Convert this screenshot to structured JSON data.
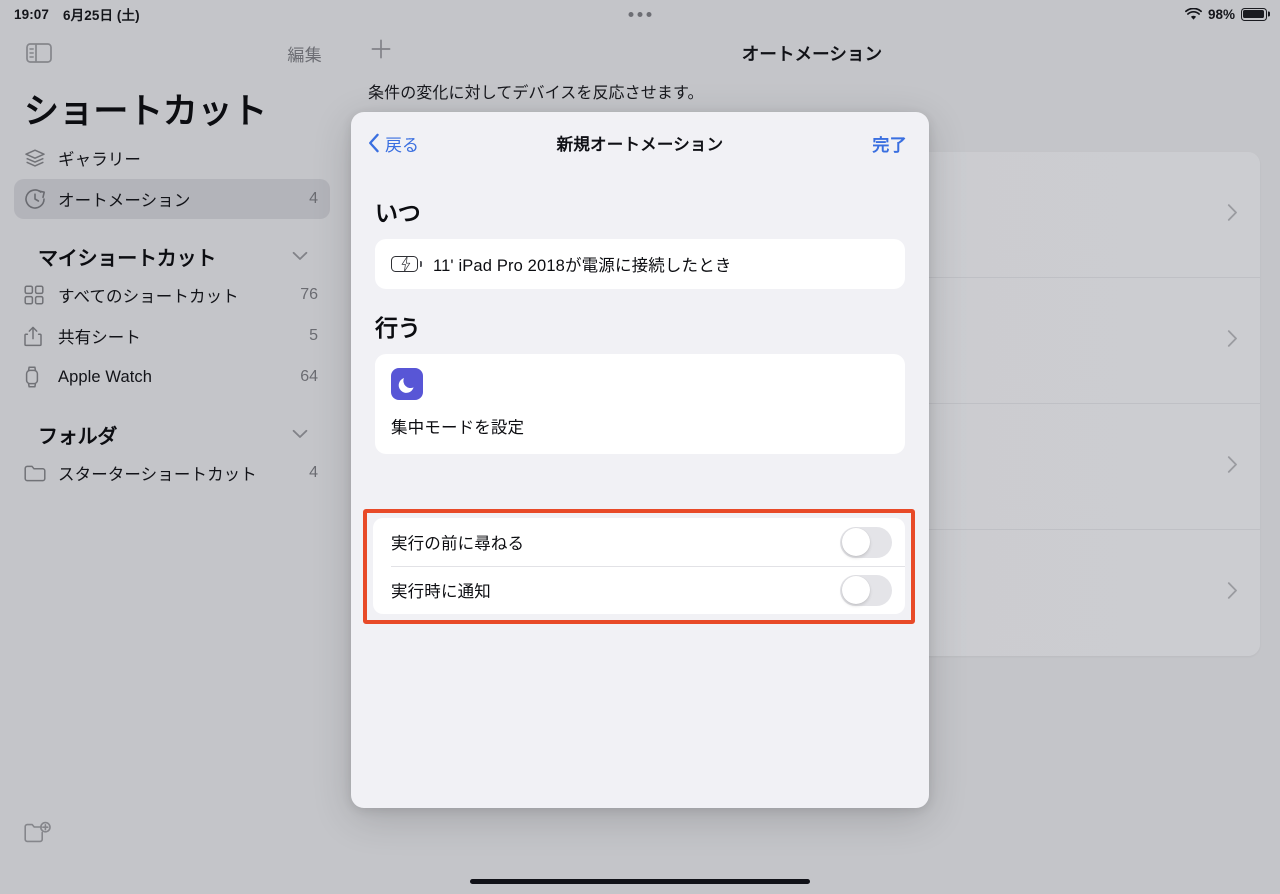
{
  "status_bar": {
    "time": "19:07",
    "date": "6月25日 (土)",
    "battery_percent": "98%",
    "wifi_icon": "wifi-icon",
    "battery_icon": "battery-icon",
    "multitask_icon": "multitasking-dots-icon"
  },
  "sidebar": {
    "toggle_icon": "sidebar-toggle-icon",
    "edit_label": "編集",
    "title": "ショートカット",
    "new_folder_icon": "new-folder-icon",
    "top_items": [
      {
        "label": "ギャラリー",
        "count": "",
        "icon": "gallery-icon",
        "selected": false
      },
      {
        "label": "オートメーション",
        "count": "4",
        "icon": "automation-clock-icon",
        "selected": true
      }
    ],
    "sections": [
      {
        "title": "マイショートカット",
        "collapse_icon": "chevron-down-icon",
        "items": [
          {
            "label": "すべてのショートカット",
            "count": "76",
            "icon": "grid-icon"
          },
          {
            "label": "共有シート",
            "count": "5",
            "icon": "share-icon"
          },
          {
            "label": "Apple Watch",
            "count": "64",
            "icon": "watch-icon"
          }
        ]
      },
      {
        "title": "フォルダ",
        "collapse_icon": "chevron-down-icon",
        "items": [
          {
            "label": "スターターショートカット",
            "count": "4",
            "icon": "folder-icon"
          }
        ]
      }
    ]
  },
  "detail": {
    "add_icon": "plus-icon",
    "title": "オートメーション",
    "subtitle": "条件の変化に対してデバイスを反応させます。",
    "background_rows": [
      {
        "chevron_icon": "chevron-right-icon"
      },
      {
        "chevron_icon": "chevron-right-icon"
      },
      {
        "chevron_icon": "chevron-right-icon"
      },
      {
        "chevron_icon": "chevron-right-icon"
      }
    ]
  },
  "sheet": {
    "back_label": "戻る",
    "back_icon": "chevron-left-icon",
    "title": "新規オートメーション",
    "done_label": "完了",
    "when": {
      "heading": "いつ",
      "trigger_icon": "battery-charging-icon",
      "trigger_text": "11' iPad Pro 2018が電源に接続したとき"
    },
    "do": {
      "heading": "行う",
      "action_icon": "focus-moon-icon",
      "action_label": "集中モードを設定"
    },
    "options": [
      {
        "label": "実行の前に尋ねる",
        "enabled": false
      },
      {
        "label": "実行時に通知",
        "enabled": false
      }
    ]
  },
  "annotation": {
    "highlight_color": "#e84a28",
    "target": "options-toggle-card"
  },
  "colors": {
    "accent_blue": "#3a6fe0",
    "focus_purple": "#5856d6",
    "battery_green": "#3ec75a",
    "window_background": "#c4c5c9",
    "sheet_background": "#f1f1f5",
    "card_white": "#ffffff"
  },
  "home_indicator": "home-indicator"
}
